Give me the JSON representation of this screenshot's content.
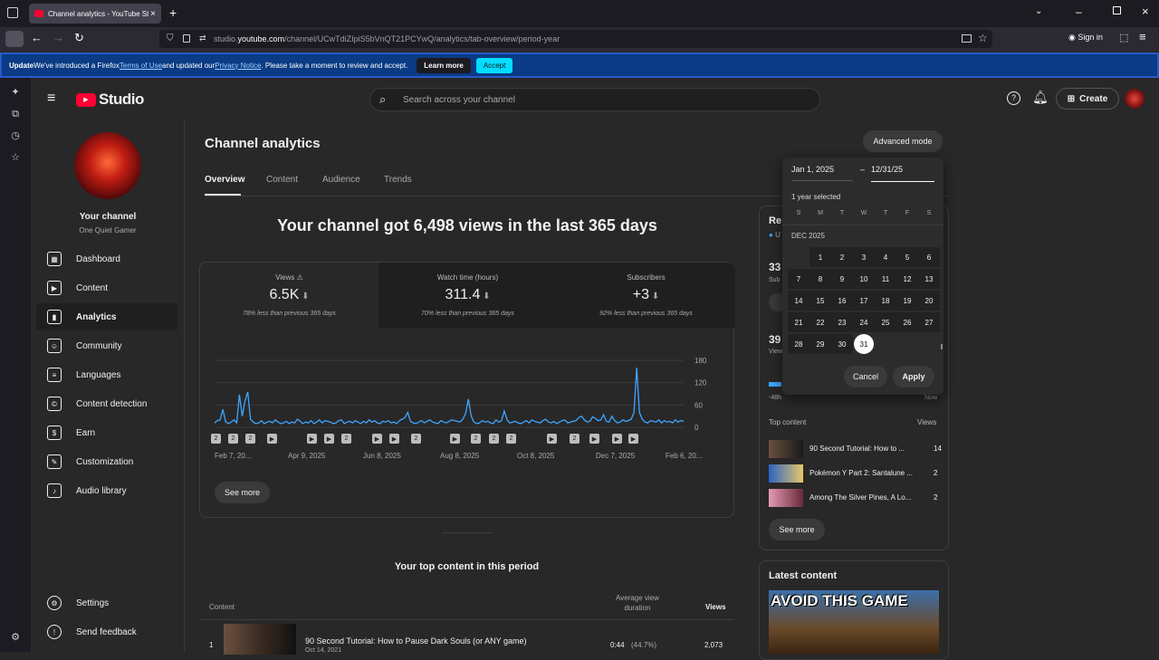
{
  "browser": {
    "tab_title": "Channel analytics - YouTube St",
    "url_prefix": "studio.",
    "url_domain": "youtube.com",
    "url_path": "/channel/UCwTdiZIpiS5bVnQT21PCYwQ/analytics/tab-overview/period-year",
    "sign_in": "Sign in"
  },
  "notice": {
    "update": "Update",
    "text1": " We've introduced a Firefox ",
    "terms": "Terms of Use",
    "text2": " and updated our ",
    "privacy": "Privacy Notice",
    "text3": ". Please take a moment to review and accept.",
    "learn_more": "Learn more",
    "accept": "Accept"
  },
  "studio": {
    "logo": "Studio",
    "search_placeholder": "Search across your channel",
    "create": "Create"
  },
  "channel": {
    "title": "Your channel",
    "name": "One Quiet Gamer"
  },
  "nav": [
    {
      "label": "Dashboard",
      "icon": "dashboard-icon",
      "glyph": "▦"
    },
    {
      "label": "Content",
      "icon": "content-icon",
      "glyph": "▶"
    },
    {
      "label": "Analytics",
      "icon": "analytics-icon",
      "glyph": "▮"
    },
    {
      "label": "Community",
      "icon": "community-icon",
      "glyph": "☺"
    },
    {
      "label": "Languages",
      "icon": "languages-icon",
      "glyph": "≡"
    },
    {
      "label": "Content detection",
      "icon": "content-detection-icon",
      "glyph": "©"
    },
    {
      "label": "Earn",
      "icon": "earn-icon",
      "glyph": "$"
    },
    {
      "label": "Customization",
      "icon": "customization-icon",
      "glyph": "✎"
    },
    {
      "label": "Audio library",
      "icon": "audio-library-icon",
      "glyph": "♪"
    }
  ],
  "nav_bottom": [
    {
      "label": "Settings",
      "icon": "settings-icon",
      "glyph": "⚙"
    },
    {
      "label": "Send feedback",
      "icon": "feedback-icon",
      "glyph": "!"
    }
  ],
  "main": {
    "page_title": "Channel analytics",
    "advanced_mode": "Advanced mode",
    "tabs": [
      "Overview",
      "Content",
      "Audience",
      "Trends"
    ],
    "headline": "Your channel got 6,498 views in the last 365 days",
    "see_more": "See more",
    "top_content_title": "Your top content in this period",
    "table_headers": {
      "content": "Content",
      "avg_view_duration": "Average view duration",
      "views": "Views"
    },
    "top_row": {
      "rank": "1",
      "title": "90 Second Tutorial: How to Pause Dark Souls (or ANY game)",
      "date": "Oct 14, 2021",
      "duration": "0:44",
      "pct": "(44.7%)",
      "views": "2,073"
    }
  },
  "stats": [
    {
      "label": "Views",
      "value": "6.5K",
      "compare": "78% less than previous 365 days"
    },
    {
      "label": "Watch time (hours)",
      "value": "311.4",
      "compare": "70% less than previous 365 days"
    },
    {
      "label": "Subscribers",
      "value": "+3",
      "compare": "92% less than previous 365 days"
    }
  ],
  "chart_data": {
    "type": "line",
    "x_tick_labels": [
      "Feb 7, 20...",
      "Apr 9, 2025",
      "Jun 8, 2025",
      "Aug 8, 2025",
      "Oct 8, 2025",
      "Dec 7, 2025",
      "Feb 6, 20..."
    ],
    "y_tick_labels": [
      "180",
      "120",
      "60",
      "0"
    ],
    "ylim": [
      0,
      180
    ],
    "series": [
      {
        "values": [
          12,
          18,
          20,
          48,
          15,
          10,
          14,
          20,
          12,
          88,
          30,
          70,
          95,
          22,
          14,
          10,
          12,
          18,
          10,
          14,
          16,
          12,
          20,
          14,
          10,
          12,
          16,
          10,
          14,
          12,
          22,
          16,
          10,
          14,
          12,
          18,
          10,
          14,
          20,
          12,
          18,
          16,
          14,
          10,
          12,
          18,
          20,
          10,
          14,
          16,
          12,
          18,
          14,
          10,
          16,
          12,
          20,
          14,
          18,
          12,
          10,
          16,
          14,
          18,
          12,
          14,
          10,
          18,
          22,
          26,
          40,
          16,
          12,
          10,
          14,
          18,
          12,
          16,
          20,
          14,
          12,
          10,
          18,
          14,
          12,
          16,
          20,
          18,
          16,
          14,
          22,
          38,
          76,
          30,
          14,
          10,
          12,
          18,
          14,
          16,
          12,
          10,
          20,
          14,
          18,
          44,
          20,
          12,
          14,
          16,
          12,
          10,
          14,
          18,
          12,
          20,
          16,
          14,
          12,
          18,
          22,
          14,
          12,
          16,
          10,
          14,
          18,
          20,
          12,
          14,
          16,
          18,
          26,
          30,
          20,
          14,
          16,
          28,
          24,
          18,
          20,
          34,
          16,
          14,
          30,
          18,
          12,
          14,
          20,
          16,
          18,
          22,
          40,
          160,
          40,
          22,
          14,
          12,
          18,
          16,
          14,
          20,
          12,
          18,
          14,
          16,
          12,
          20,
          14,
          18,
          16
        ]
      }
    ],
    "colors": {
      "line": "#3ea6ff"
    }
  },
  "markers": [
    "2",
    "2",
    "2",
    "▶",
    "▶",
    "▶",
    "2",
    "▶",
    "▶",
    "2",
    "▶",
    "2",
    "2",
    "2",
    "▶",
    "2",
    "▶",
    "▶",
    "▶"
  ],
  "picker": {
    "start": "Jan 1, 2025",
    "dash": "–",
    "end": "12/31/25",
    "selected_text": "1 year selected",
    "weekdays": [
      "S",
      "M",
      "T",
      "W",
      "T",
      "F",
      "S"
    ],
    "month": "DEC 2025",
    "days": [
      "1",
      "2",
      "3",
      "4",
      "5",
      "6",
      "7",
      "8",
      "9",
      "10",
      "11",
      "12",
      "13",
      "14",
      "15",
      "16",
      "17",
      "18",
      "19",
      "20",
      "21",
      "22",
      "23",
      "24",
      "25",
      "26",
      "27",
      "28",
      "29",
      "30",
      "31"
    ],
    "cancel": "Cancel",
    "apply": "Apply"
  },
  "right_card": {
    "title_partial": "Re",
    "sub_partial": "U",
    "num1": "33",
    "num1_label": "Sub",
    "num2": "39",
    "num2_label": "View",
    "axis_left": "-48h",
    "axis_right": "Now",
    "top_content": "Top content",
    "views": "Views",
    "items": [
      {
        "title": "90 Second Tutorial: How to ...",
        "views": "14"
      },
      {
        "title": "Pokémon Y Part 2: Santalune ...",
        "views": "2"
      },
      {
        "title": "Among The Silver Pines, A Lo...",
        "views": "2"
      }
    ],
    "see_more": "See more",
    "latest_content": "Latest content",
    "thumb_text": "AVOID THIS GAME"
  }
}
